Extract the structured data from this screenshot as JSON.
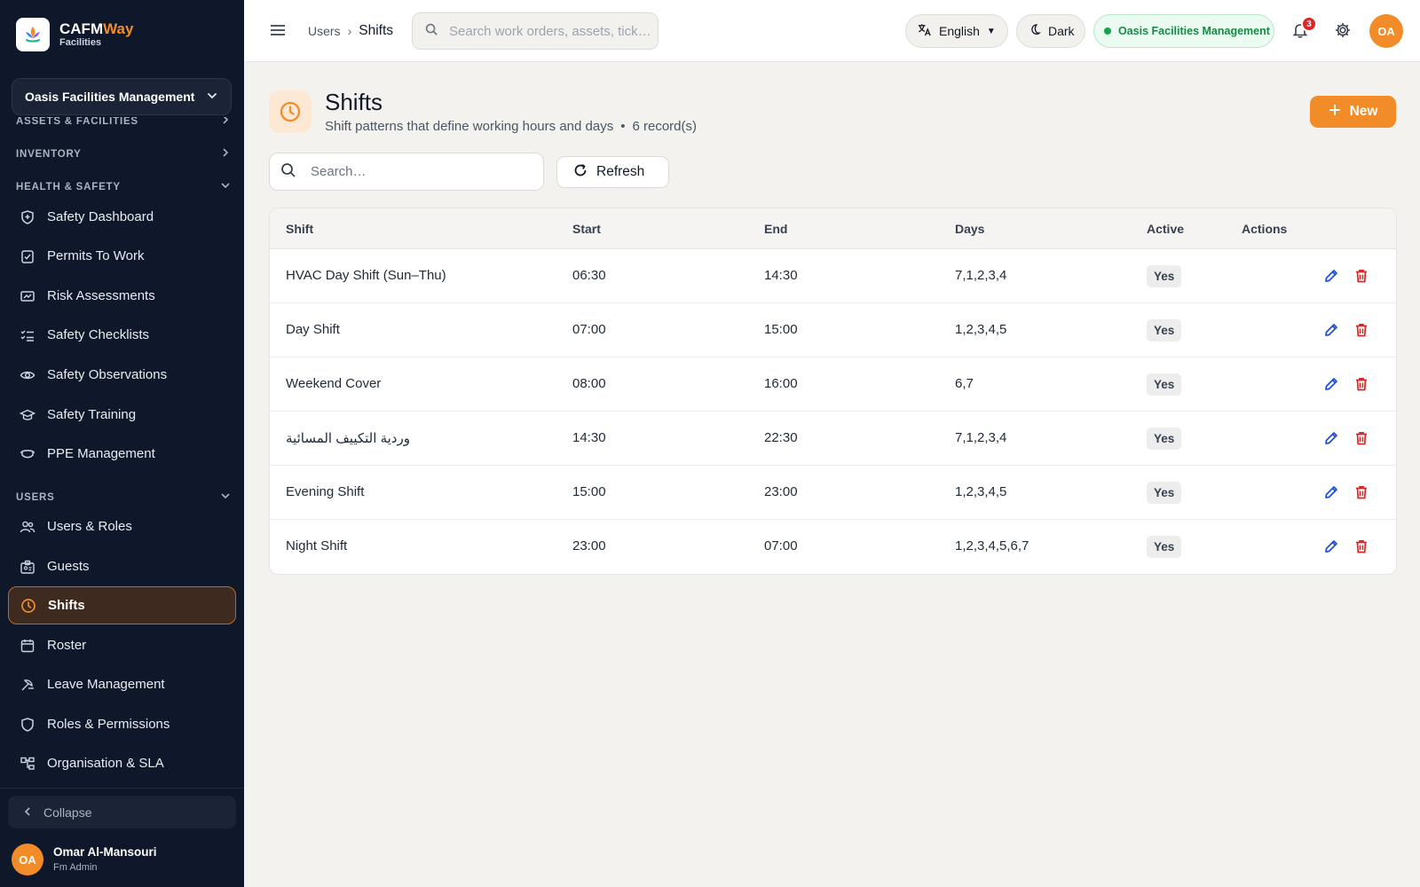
{
  "brand": {
    "name_main": "CAFM",
    "name_accent": "Way",
    "subtitle": "Facilities"
  },
  "org_selector": {
    "value": "Oasis Facilities Management"
  },
  "sidebar": {
    "sections": {
      "assets": "ASSETS & FACILITIES",
      "inventory": "INVENTORY",
      "health_safety": "HEALTH & SAFETY",
      "users": "USERS"
    },
    "health_safety_items": [
      {
        "label": "Safety Dashboard",
        "icon": "shield-icon"
      },
      {
        "label": "Permits To Work",
        "icon": "clipboard-check-icon"
      },
      {
        "label": "Risk Assessments",
        "icon": "risk-card-icon"
      },
      {
        "label": "Safety Checklists",
        "icon": "checklist-icon"
      },
      {
        "label": "Safety Observations",
        "icon": "eye-icon"
      },
      {
        "label": "Safety Training",
        "icon": "graduation-cap-icon"
      },
      {
        "label": "PPE Management",
        "icon": "mask-icon"
      }
    ],
    "users_items": [
      {
        "label": "Users & Roles",
        "icon": "users-icon"
      },
      {
        "label": "Guests",
        "icon": "badge-icon"
      },
      {
        "label": "Shifts",
        "icon": "clock-icon",
        "active": true
      },
      {
        "label": "Roster",
        "icon": "calendar-icon"
      },
      {
        "label": "Leave Management",
        "icon": "leave-icon"
      },
      {
        "label": "Roles & Permissions",
        "icon": "shield-outline-icon"
      },
      {
        "label": "Organisation & SLA",
        "icon": "org-chart-icon"
      }
    ],
    "collapse_label": "Collapse",
    "user": {
      "initials": "OA",
      "name": "Omar Al-Mansouri",
      "role": "Fm Admin"
    }
  },
  "topbar": {
    "breadcrumb": {
      "parent": "Users",
      "current": "Shifts"
    },
    "search_placeholder": "Search work orders, assets, tick…",
    "language": "English",
    "theme": "Dark",
    "org_status": "Oasis Facilities Management",
    "notification_count": "3",
    "avatar_initials": "OA"
  },
  "page": {
    "title": "Shifts",
    "subtitle": "Shift patterns that define working hours and days",
    "record_count": "6 record(s)",
    "new_label": "New",
    "search_placeholder": "Search…",
    "refresh_label": "Refresh"
  },
  "table": {
    "columns": [
      "Shift",
      "Start",
      "End",
      "Days",
      "Active",
      "Actions"
    ],
    "rows": [
      {
        "shift": "HVAC Day Shift (Sun–Thu)",
        "start": "06:30",
        "end": "14:30",
        "days": "7,1,2,3,4",
        "active": "Yes"
      },
      {
        "shift": "Day Shift",
        "start": "07:00",
        "end": "15:00",
        "days": "1,2,3,4,5",
        "active": "Yes"
      },
      {
        "shift": "Weekend Cover",
        "start": "08:00",
        "end": "16:00",
        "days": "6,7",
        "active": "Yes"
      },
      {
        "shift": "وردية التكييف المسائية",
        "start": "14:30",
        "end": "22:30",
        "days": "7,1,2,3,4",
        "active": "Yes"
      },
      {
        "shift": "Evening Shift",
        "start": "15:00",
        "end": "23:00",
        "days": "1,2,3,4,5",
        "active": "Yes"
      },
      {
        "shift": "Night Shift",
        "start": "23:00",
        "end": "07:00",
        "days": "1,2,3,4,5,6,7",
        "active": "Yes"
      }
    ]
  },
  "colors": {
    "accent": "#f28c28",
    "sidebar_bg": "#0f172a",
    "edit": "#1d4ed8",
    "delete": "#dc2626",
    "success": "#16a34a"
  }
}
